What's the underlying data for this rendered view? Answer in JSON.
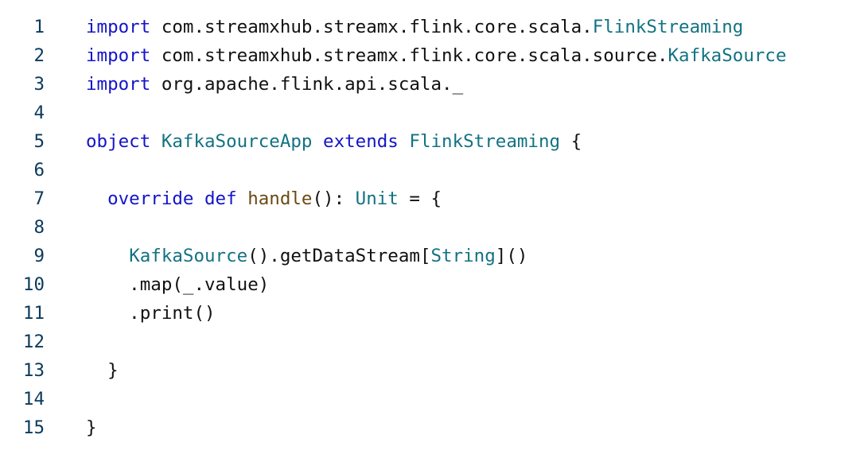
{
  "code": {
    "lines": [
      {
        "number": "1",
        "tokens": [
          {
            "text": "import",
            "kind": "kw"
          },
          {
            "text": " com.streamxhub.streamx.flink.core.scala.",
            "kind": "pl"
          },
          {
            "text": "FlinkStreaming",
            "kind": "ty"
          }
        ]
      },
      {
        "number": "2",
        "tokens": [
          {
            "text": "import",
            "kind": "kw"
          },
          {
            "text": " com.streamxhub.streamx.flink.core.scala.source.",
            "kind": "pl"
          },
          {
            "text": "KafkaSource",
            "kind": "ty"
          }
        ]
      },
      {
        "number": "3",
        "tokens": [
          {
            "text": "import",
            "kind": "kw"
          },
          {
            "text": " org.apache.flink.api.scala._",
            "kind": "pl"
          }
        ]
      },
      {
        "number": "4",
        "tokens": []
      },
      {
        "number": "5",
        "tokens": [
          {
            "text": "object",
            "kind": "kw"
          },
          {
            "text": " ",
            "kind": "pl"
          },
          {
            "text": "KafkaSourceApp",
            "kind": "ty"
          },
          {
            "text": " ",
            "kind": "pl"
          },
          {
            "text": "extends",
            "kind": "kw"
          },
          {
            "text": " ",
            "kind": "pl"
          },
          {
            "text": "FlinkStreaming",
            "kind": "ty"
          },
          {
            "text": " {",
            "kind": "pl"
          }
        ]
      },
      {
        "number": "6",
        "tokens": []
      },
      {
        "number": "7",
        "tokens": [
          {
            "text": "  ",
            "kind": "pl"
          },
          {
            "text": "override",
            "kind": "kw"
          },
          {
            "text": " ",
            "kind": "pl"
          },
          {
            "text": "def",
            "kind": "kw"
          },
          {
            "text": " ",
            "kind": "pl"
          },
          {
            "text": "handle",
            "kind": "fn"
          },
          {
            "text": "(): ",
            "kind": "pl"
          },
          {
            "text": "Unit",
            "kind": "ty"
          },
          {
            "text": " = {",
            "kind": "pl"
          }
        ]
      },
      {
        "number": "8",
        "tokens": []
      },
      {
        "number": "9",
        "tokens": [
          {
            "text": "    ",
            "kind": "pl"
          },
          {
            "text": "KafkaSource",
            "kind": "ty"
          },
          {
            "text": "().getDataStream[",
            "kind": "pl"
          },
          {
            "text": "String",
            "kind": "ty"
          },
          {
            "text": "]()",
            "kind": "pl"
          }
        ]
      },
      {
        "number": "10",
        "tokens": [
          {
            "text": "    .map(_.value)",
            "kind": "pl"
          }
        ]
      },
      {
        "number": "11",
        "tokens": [
          {
            "text": "    .print()",
            "kind": "pl"
          }
        ]
      },
      {
        "number": "12",
        "tokens": []
      },
      {
        "number": "13",
        "tokens": [
          {
            "text": "  }",
            "kind": "pl"
          }
        ]
      },
      {
        "number": "14",
        "tokens": []
      },
      {
        "number": "15",
        "tokens": [
          {
            "text": "}",
            "kind": "pl"
          }
        ]
      }
    ]
  },
  "colors": {
    "keyword": "#1414c8",
    "type": "#137282",
    "function": "#6b4a14",
    "plain": "#111111",
    "line_number": "#0b3a5c",
    "background": "#ffffff"
  }
}
